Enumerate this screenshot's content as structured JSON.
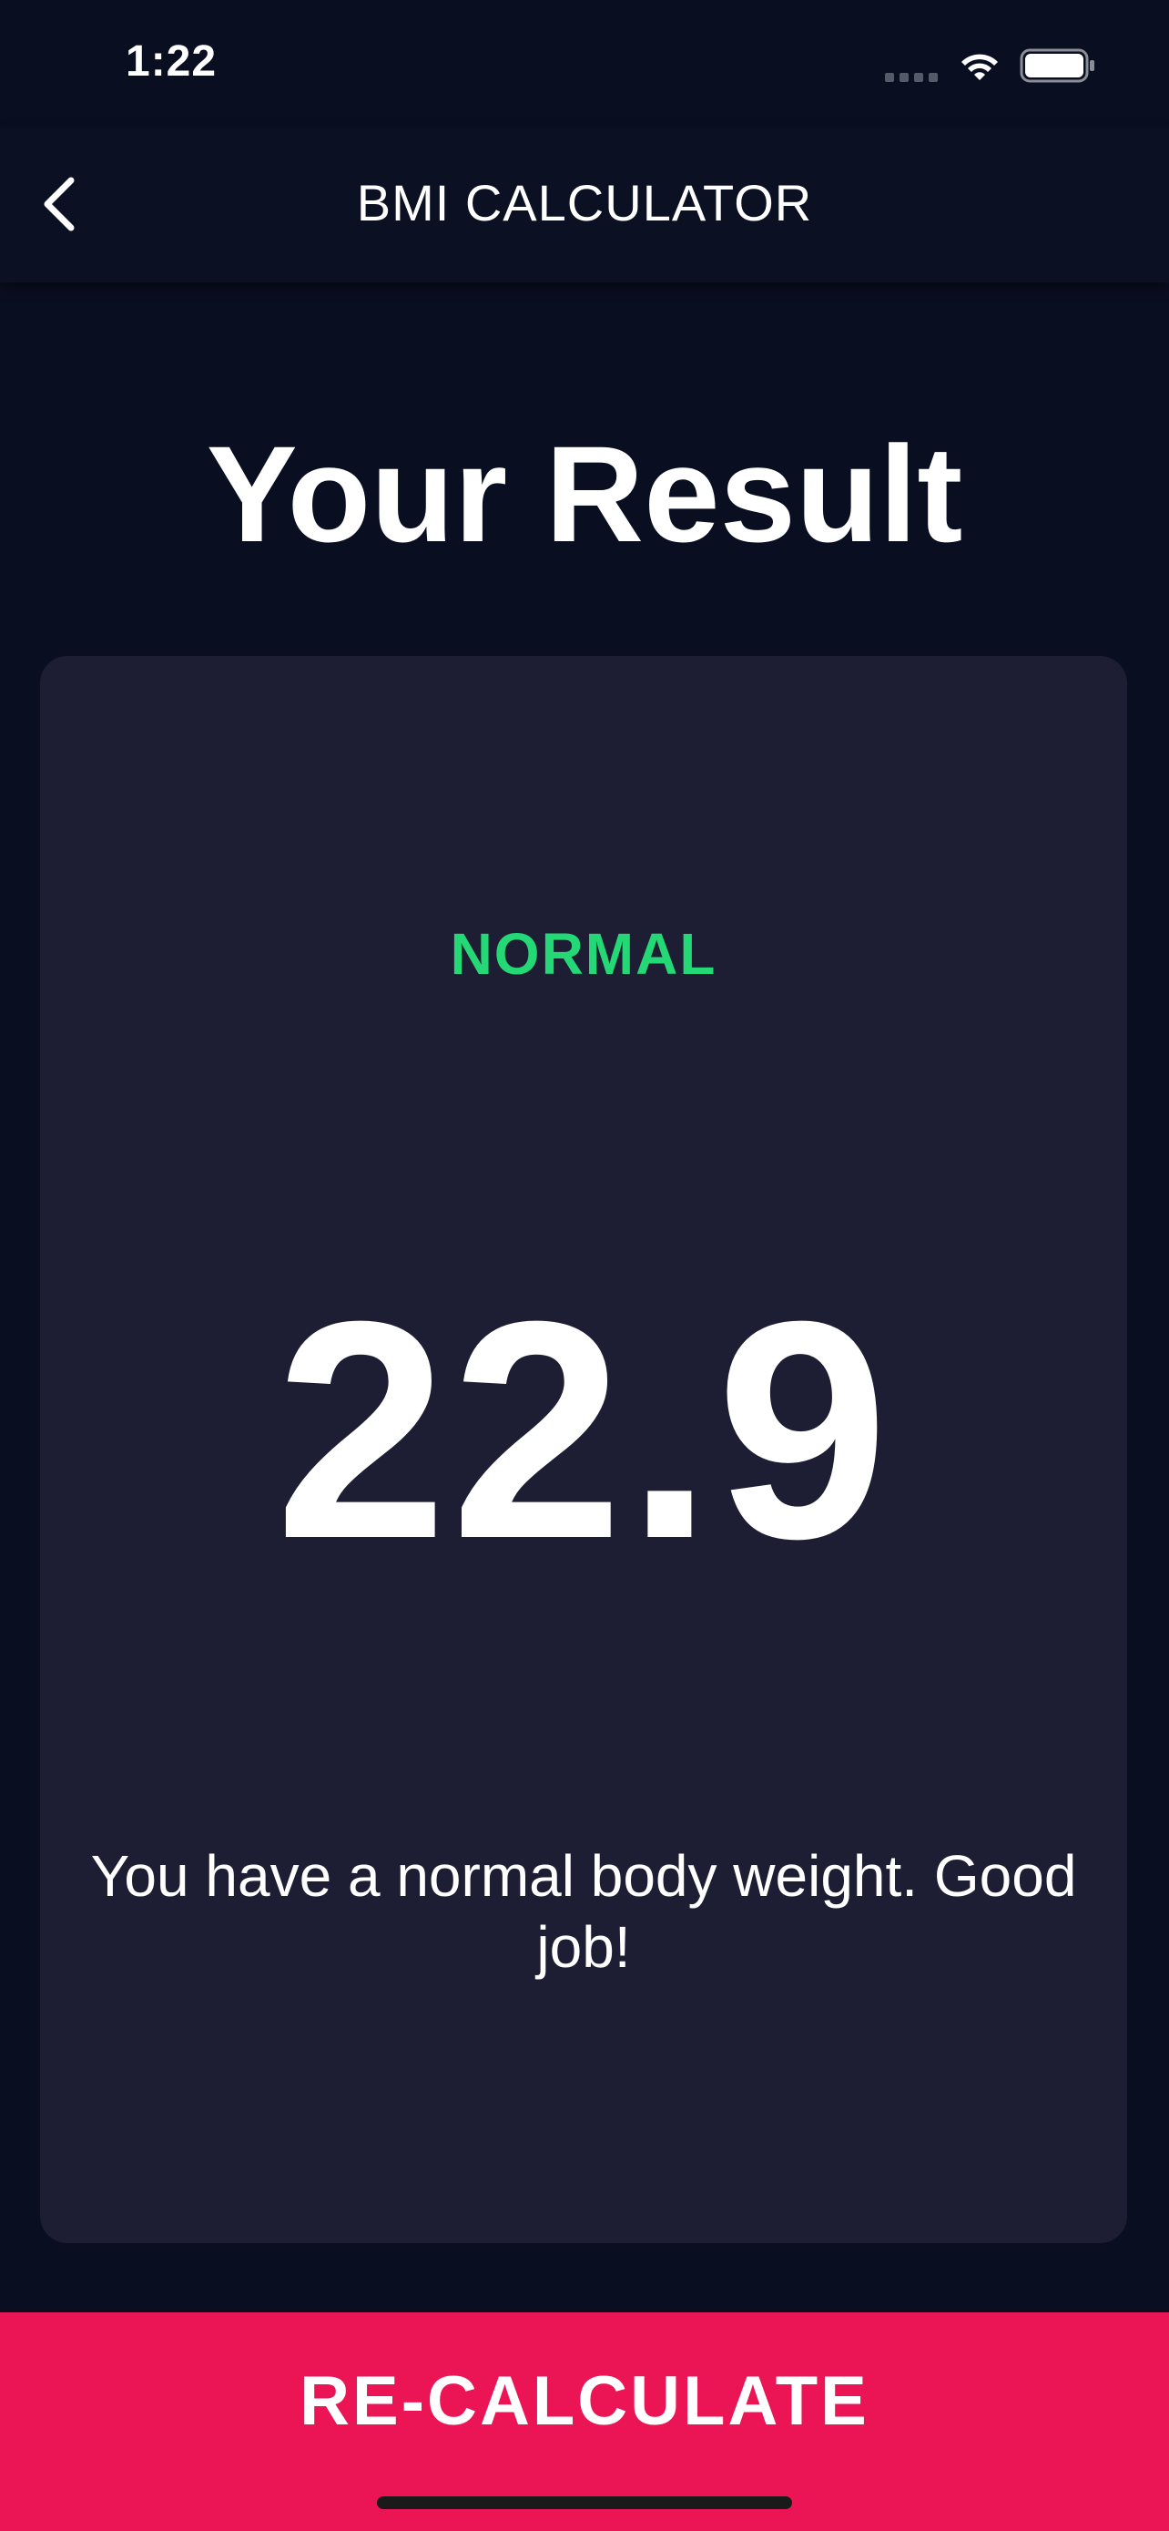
{
  "status_bar": {
    "time": "1:22",
    "icons": [
      "cellular-signal-icon",
      "wifi-icon",
      "battery-icon"
    ]
  },
  "app_bar": {
    "title": "BMI CALCULATOR",
    "back_icon": "chevron-left-icon"
  },
  "page": {
    "title": "Your Result"
  },
  "result": {
    "status": "NORMAL",
    "value": "22.9",
    "message": "You have a normal body weight. Good job!"
  },
  "actions": {
    "recalculate_label": "RE-CALCULATE"
  },
  "colors": {
    "background": "#0a0e21",
    "app_bar": "#0b1023",
    "card": "#1d1e33",
    "status_normal": "#24d876",
    "accent": "#eb1555",
    "text": "#ffffff"
  }
}
